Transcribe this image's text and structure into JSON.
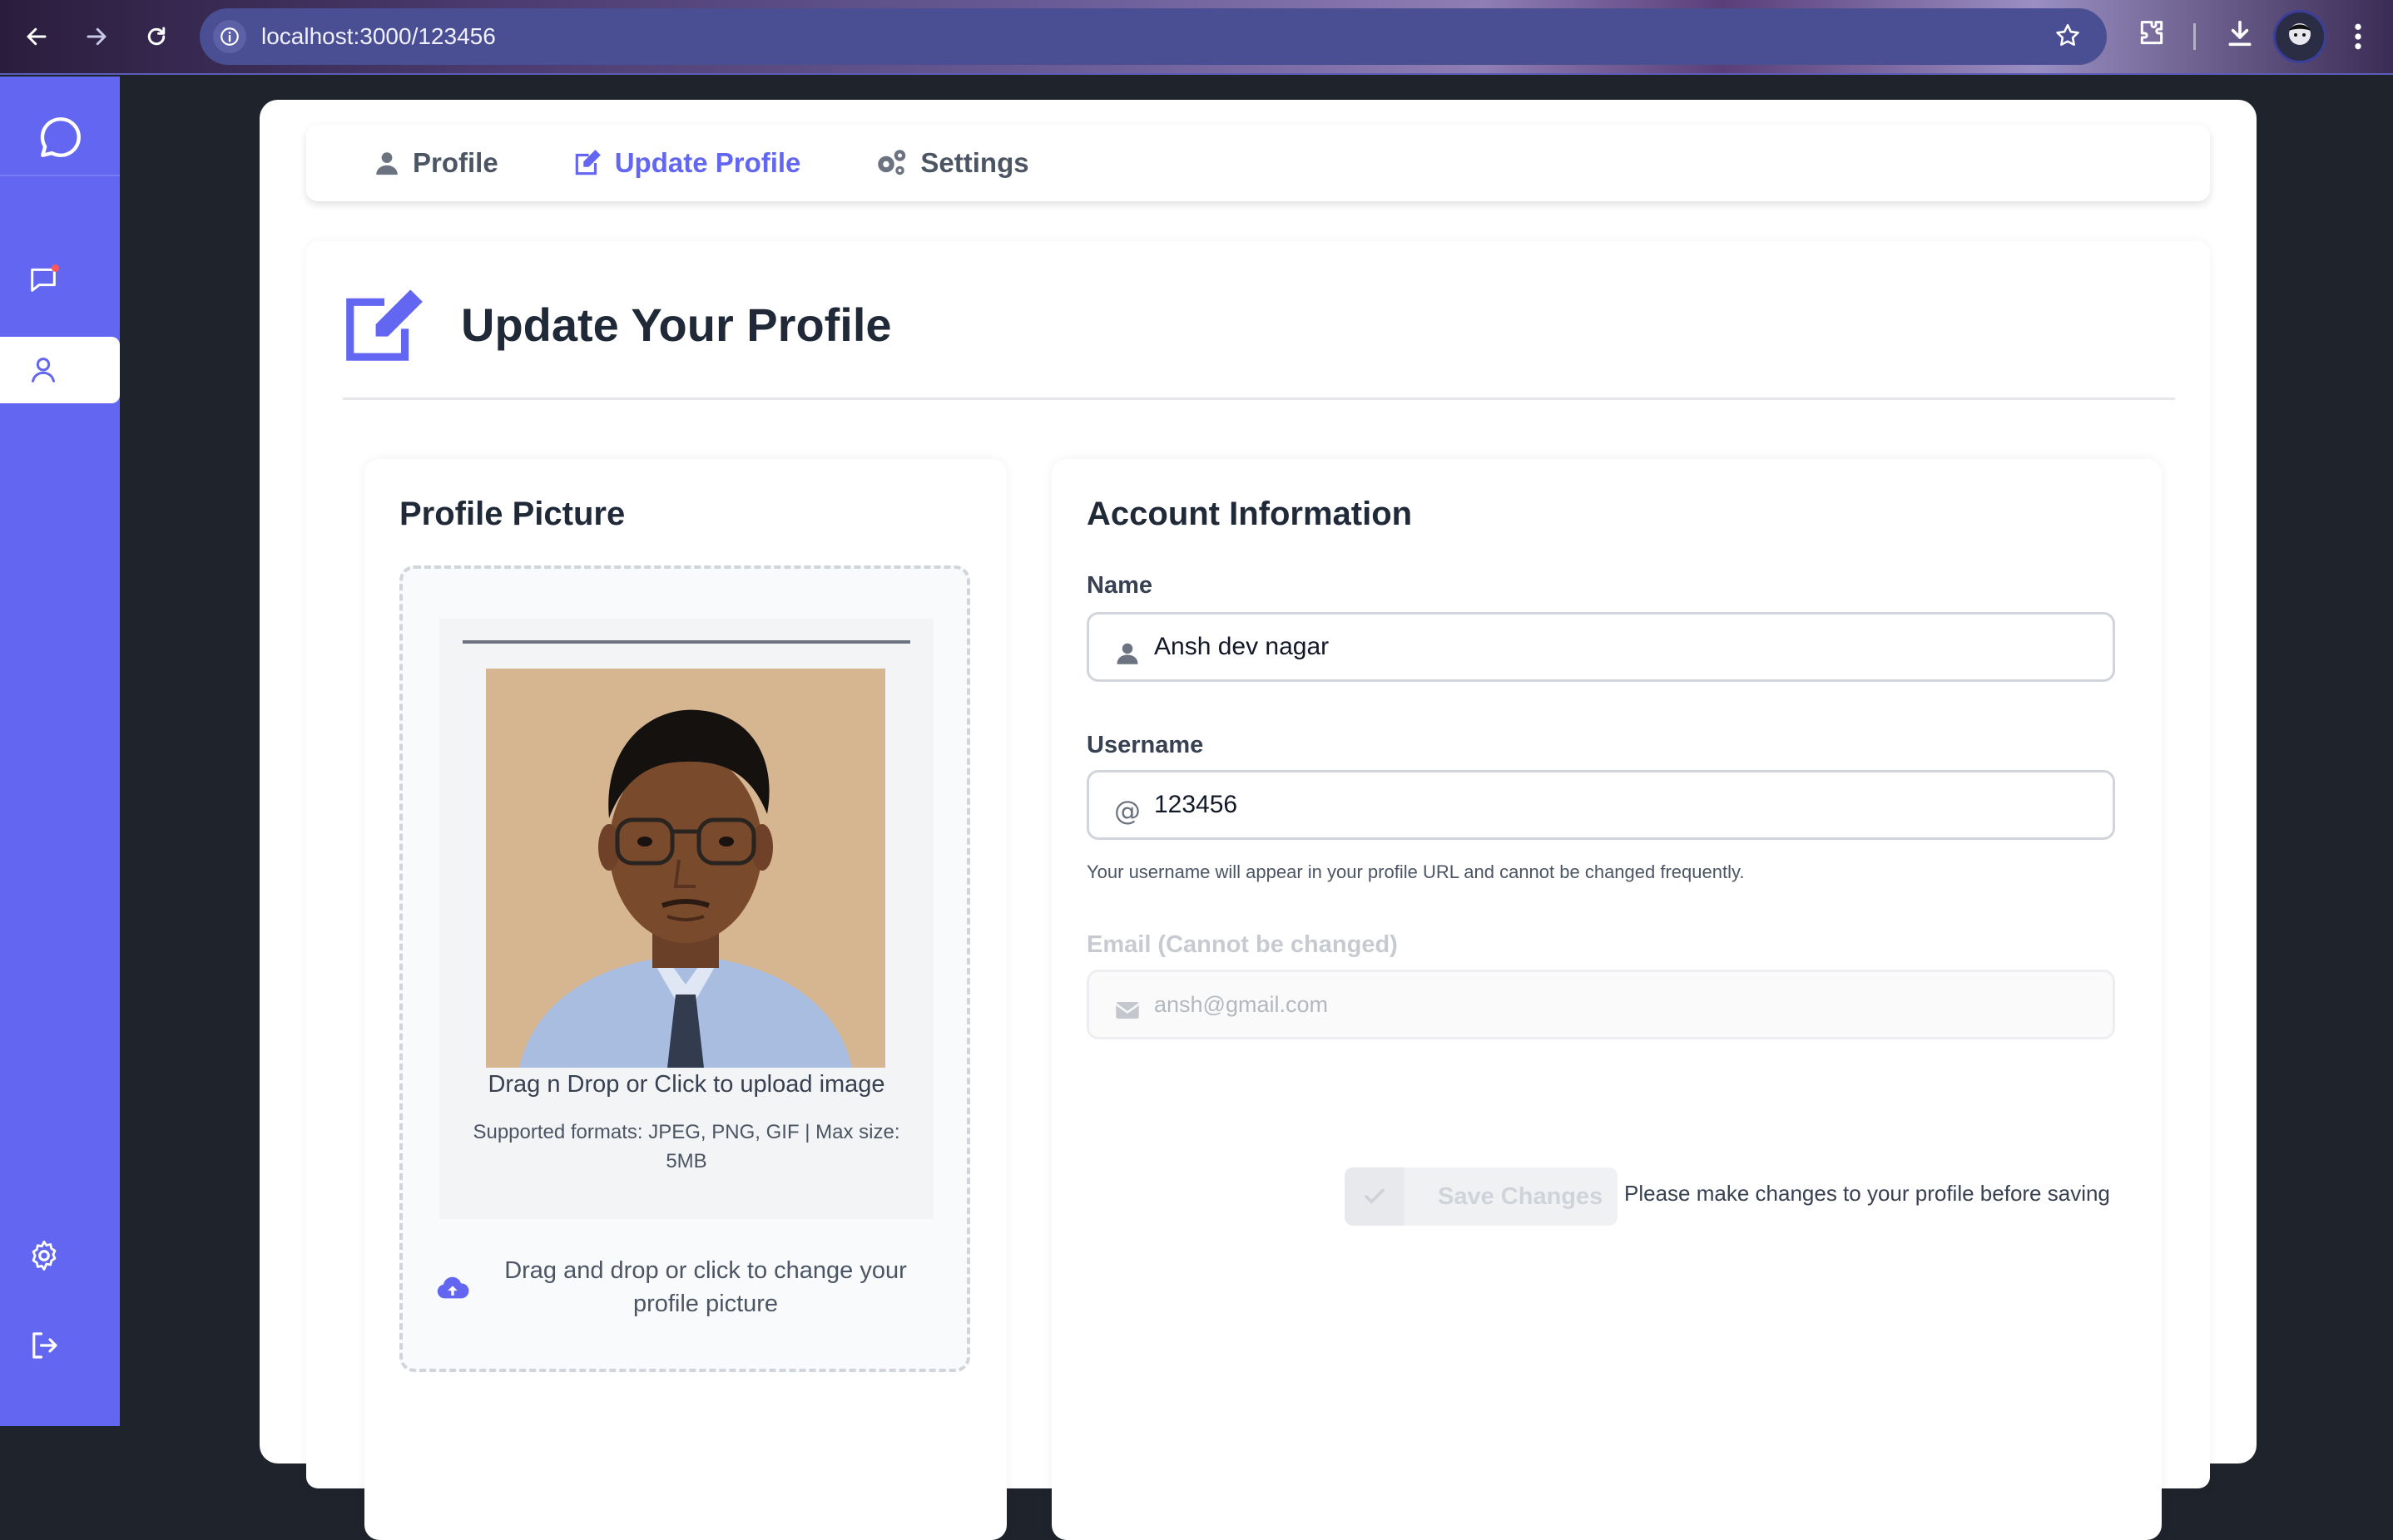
{
  "browser": {
    "url": "localhost:3000/123456"
  },
  "tabs": [
    {
      "label": "Profile",
      "active": false
    },
    {
      "label": "Update Profile",
      "active": true
    },
    {
      "label": "Settings",
      "active": false
    }
  ],
  "page": {
    "title": "Update Your Profile"
  },
  "picture_panel": {
    "title": "Profile Picture",
    "upload_label": "Drag n Drop or Click to upload image",
    "upload_hint": "Supported formats: JPEG, PNG, GIF | Max size: 5MB",
    "change_text": "Drag and drop or click to change your profile picture"
  },
  "account_panel": {
    "title": "Account Information",
    "name_label": "Name",
    "name_value": "Ansh dev nagar",
    "username_label": "Username",
    "username_value": "123456",
    "username_help": "Your username will appear in your profile URL and cannot be changed frequently.",
    "email_label": "Email (Cannot be changed)",
    "email_value": "ansh@gmail.com",
    "save_label": "Save Changes",
    "save_note": "Please make changes to your profile before saving"
  },
  "colors": {
    "accent": "#6366f1",
    "sidebar": "#6366f1",
    "text_dark": "#1f2937"
  }
}
